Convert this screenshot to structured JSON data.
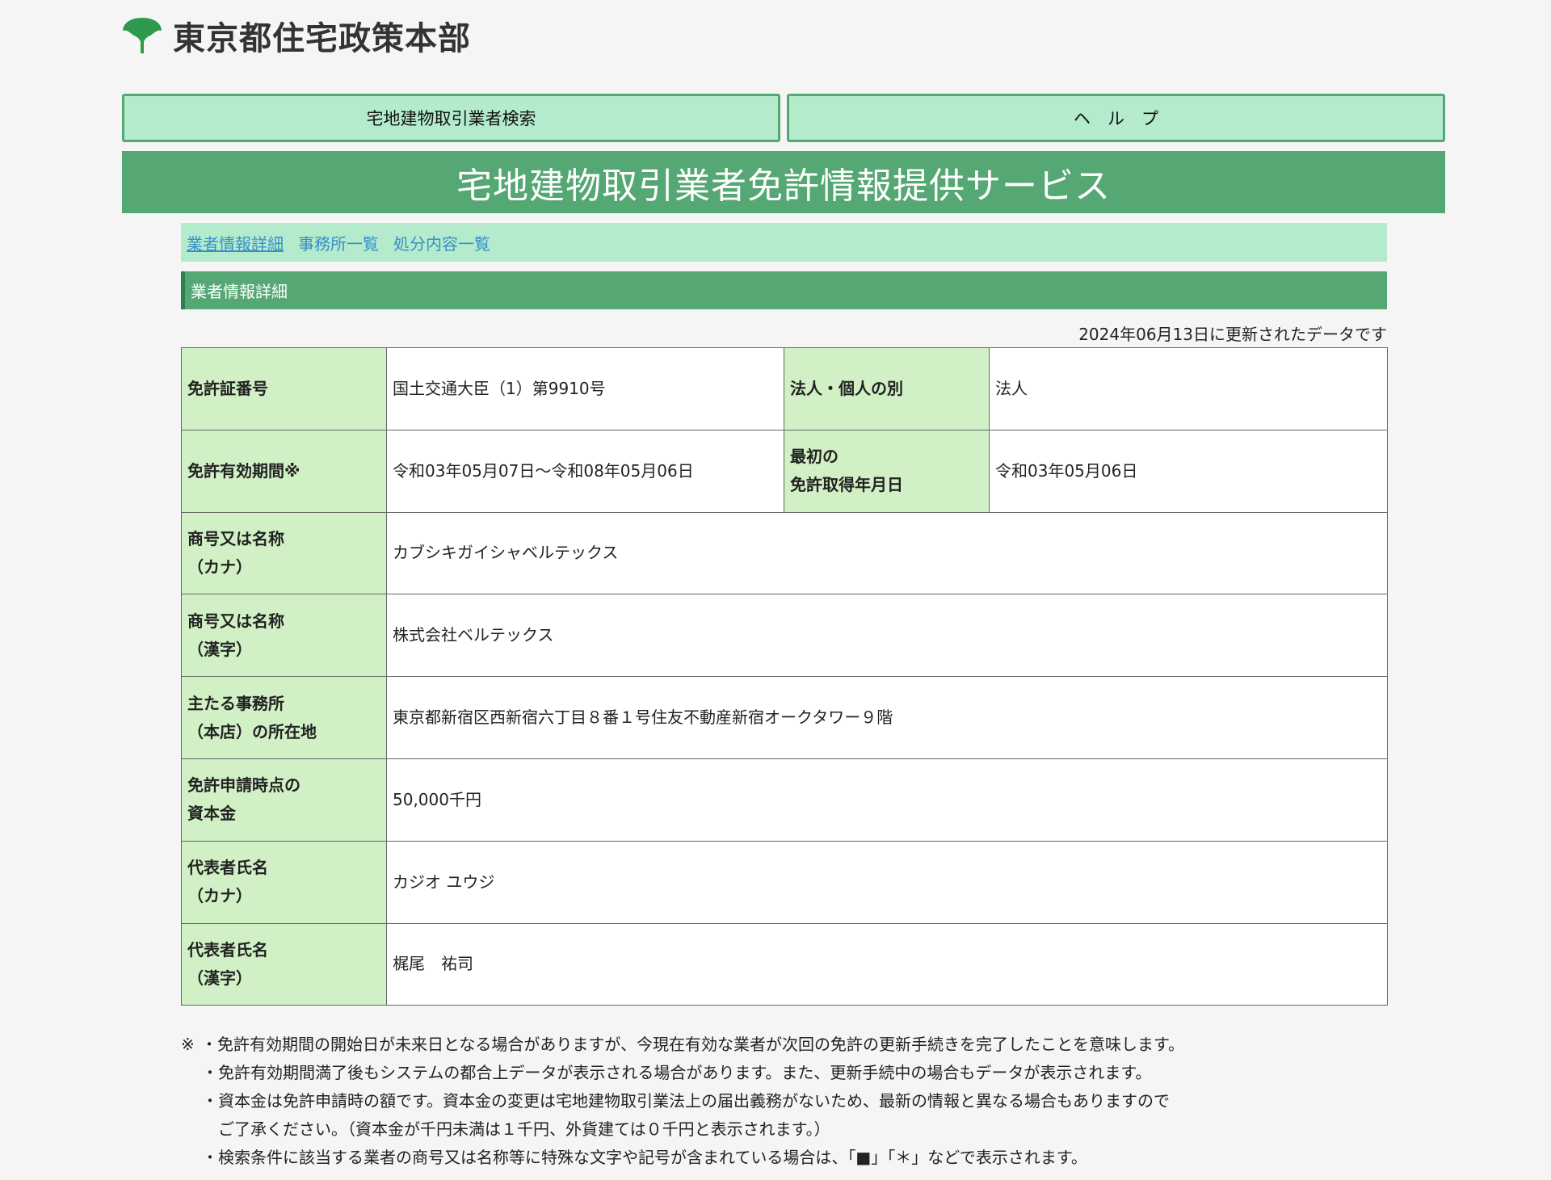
{
  "header": {
    "title": "東京都住宅政策本部",
    "logo_icon": "ginkgo-leaf-icon",
    "logo_color": "#2f9a4e"
  },
  "top_nav": {
    "search_label": "宅地建物取引業者検索",
    "help_label": "ヘ　ル　プ"
  },
  "banner": {
    "title": "宅地建物取引業者免許情報提供サービス"
  },
  "sub_nav": {
    "items": [
      "業者情報詳細",
      "事務所一覧",
      "処分内容一覧"
    ]
  },
  "section": {
    "heading": "業者情報詳細",
    "update_note": "2024年06月13日に更新されたデータです"
  },
  "details": {
    "license_number_label": "免許証番号",
    "license_number": "国土交通大臣（1）第9910号",
    "entity_type_label": "法人・個人の別",
    "entity_type": "法人",
    "validity_label": "免許有効期間※",
    "validity": "令和03年05月07日～令和08年05月06日",
    "first_license_label_1": "最初の",
    "first_license_label_2": "免許取得年月日",
    "first_license_date": "令和03年05月06日",
    "name_kana_label_1": "商号又は名称",
    "name_kana_label_2": "（カナ）",
    "name_kana": "カブシキガイシャベルテックス",
    "name_kanji_label_1": "商号又は名称",
    "name_kanji_label_2": "（漢字）",
    "name_kanji": "株式会社ベルテックス",
    "office_label_1": "主たる事務所",
    "office_label_2": "（本店）の所在地",
    "office_address": "東京都新宿区西新宿六丁目８番１号住友不動産新宿オークタワー９階",
    "capital_label_1": "免許申請時点の",
    "capital_label_2": "資本金",
    "capital": "50,000千円",
    "rep_kana_label_1": "代表者氏名",
    "rep_kana_label_2": "（カナ）",
    "rep_kana": "カジオ ユウジ",
    "rep_kanji_label_1": "代表者氏名",
    "rep_kanji_label_2": "（漢字）",
    "rep_kanji": "梶尾　祐司"
  },
  "notes": {
    "mark": "※",
    "line1": "・免許有効期間の開始日が未来日となる場合がありますが、今現在有効な業者が次回の免許の更新手続きを完了したことを意味します。",
    "line2": "・免許有効期間満了後もシステムの都合上データが表示される場合があります。また、更新手続中の場合もデータが表示されます。",
    "line3": "・資本金は免許申請時の額です。資本金の変更は宅地建物取引業法上の届出義務がないため、最新の情報と異なる場合もありますので",
    "line4": "ご了承ください。（資本金が千円未満は１千円、外貨建ては０千円と表示されます。）",
    "line5": "・検索条件に該当する業者の商号又は名称等に特殊な文字や記号が含まれている場合は、「■」「＊」などで表示されます。"
  }
}
